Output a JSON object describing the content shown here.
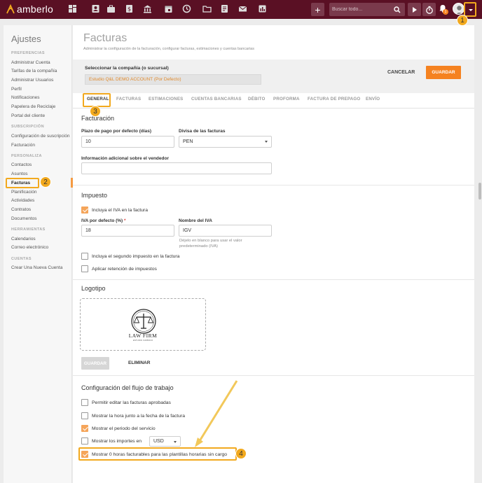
{
  "app": {
    "brand": "amberlo",
    "search_placeholder": "Buscar todo...",
    "nav_icons": [
      "dashboard-icon",
      "contacts-icon",
      "briefcase-icon",
      "billing-icon",
      "bank-icon",
      "calendar-icon",
      "time-history-icon",
      "folder-icon",
      "documents-icon",
      "mail-icon",
      "reports-icon"
    ],
    "bell_count": "1",
    "colors": {
      "topbar": "#5a1024",
      "accent": "#f58220",
      "highlight": "#f2a91e"
    }
  },
  "callouts": [
    "1",
    "2",
    "3",
    "4"
  ],
  "sidebar": {
    "title": "Ajustes",
    "sections": [
      {
        "heading": "PREFERENCIAS",
        "items": [
          "Administrar Cuenta",
          "Tarifas de la compañía",
          "Administrar Usuarios",
          "Perfil",
          "Notificaciones",
          "Papelera de Reciclaje",
          "Portal del cliente"
        ]
      },
      {
        "heading": "SUBSCRIPCIÓN",
        "items": [
          "Configuración de suscripción",
          "Facturación"
        ]
      },
      {
        "heading": "PERSONALIZA",
        "items": [
          "Contactos",
          "Asuntos",
          "Facturas",
          "Planificación",
          "Actividades",
          "Contratos",
          "Documentos"
        ]
      },
      {
        "heading": "HERRAMIENTAS",
        "items": [
          "Calendarios",
          "Correo electrónico"
        ]
      },
      {
        "heading": "CUENTAS",
        "items": [
          "Crear Una Nueva Cuenta"
        ]
      }
    ],
    "active_item": "Facturas"
  },
  "page": {
    "title": "Facturas",
    "subtitle": "Administrar la configuración de la facturación, configurar facturas, estimaciones y cuentas bancarias"
  },
  "company": {
    "label": "Seleccionar la compañía (o sucursal)",
    "value": "Estudio Q&L DEMO ACCOUNT (Por Defecto)",
    "cancel": "CANCELAR",
    "save": "GUARDAR"
  },
  "tabs": [
    "GENERAL",
    "FACTURAS",
    "ESTIMACIONES",
    "CUENTAS BANCARIAS",
    "DÉBITO",
    "PROFORMA",
    "FACTURA DE PREPAGO",
    "ENVÍO"
  ],
  "facturacion": {
    "title": "Facturación",
    "payment_term_label": "Plazo de pago por defecto (días)",
    "payment_term_value": "10",
    "currency_label": "Divisa de las facturas",
    "currency_value": "PEN",
    "vendor_info_label": "Información adicional sobre el vendedor",
    "vendor_info_value": ""
  },
  "impuesto": {
    "title": "Impuesto",
    "include_iva_label": "Incluya el IVA en la factura",
    "include_iva_checked": true,
    "iva_default_label": "IVA por defecto (%)",
    "iva_required_mark": "*",
    "iva_default_value": "18",
    "iva_name_label": "Nombre del IVA",
    "iva_name_value": "IGV",
    "iva_name_help": "Déjelo en blanco para usar el valor predeterminado (IVA)",
    "second_tax_label": "Incluya el segundo impuesto en la factura",
    "second_tax_checked": false,
    "withholding_label": "Aplicar retención de impuestos",
    "withholding_checked": false
  },
  "logotipo": {
    "title": "Logotipo",
    "logo_text": "LAW FIRM",
    "logo_tagline": "ESTUDIO JURÍDICO",
    "save": "GUARDAR",
    "delete": "ELIMINAR"
  },
  "workflow": {
    "title": "Configuración del flujo de trabajo",
    "items": [
      {
        "label": "Permitir editar las facturas aprobadas",
        "checked": false
      },
      {
        "label": "Mostrar la hora junto a la fecha de la factura",
        "checked": false
      },
      {
        "label": "Mostrar el periodo del servicio",
        "checked": true
      },
      {
        "label": "Mostrar los importes en",
        "checked": false
      },
      {
        "label": "Mostrar 0 horas facturables para las plantillas horarias sin cargo",
        "checked": true
      }
    ],
    "amount_currency": "USD"
  }
}
